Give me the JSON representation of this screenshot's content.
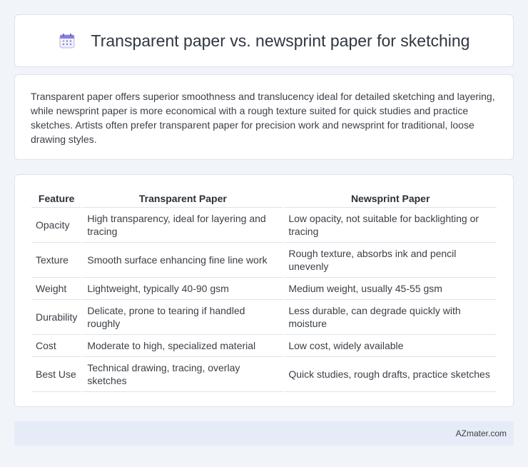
{
  "header": {
    "title": "Transparent paper vs. newsprint paper for sketching",
    "icon": "calendar-icon"
  },
  "summary": {
    "text": "Transparent paper offers superior smoothness and translucency ideal for detailed sketching and layering, while newsprint paper is more economical with a rough texture suited for quick studies and practice sketches. Artists often prefer transparent paper for precision work and newsprint for traditional, loose drawing styles."
  },
  "table": {
    "headers": [
      "Feature",
      "Transparent Paper",
      "Newsprint Paper"
    ],
    "rows": [
      [
        "Opacity",
        "High transparency, ideal for layering and tracing",
        "Low opacity, not suitable for backlighting or tracing"
      ],
      [
        "Texture",
        "Smooth surface enhancing fine line work",
        "Rough texture, absorbs ink and pencil unevenly"
      ],
      [
        "Weight",
        "Lightweight, typically 40-90 gsm",
        "Medium weight, usually 45-55 gsm"
      ],
      [
        "Durability",
        "Delicate, prone to tearing if handled roughly",
        "Less durable, can degrade quickly with moisture"
      ],
      [
        "Cost",
        "Moderate to high, specialized material",
        "Low cost, widely available"
      ],
      [
        "Best Use",
        "Technical drawing, tracing, overlay sketches",
        "Quick studies, rough drafts, practice sketches"
      ]
    ]
  },
  "footer": {
    "brand": "AZmater.com"
  },
  "colors": {
    "background": "#f1f4f9",
    "card": "#ffffff",
    "footer": "#e6ecf7",
    "icon_accent": "#8a7fd8"
  }
}
